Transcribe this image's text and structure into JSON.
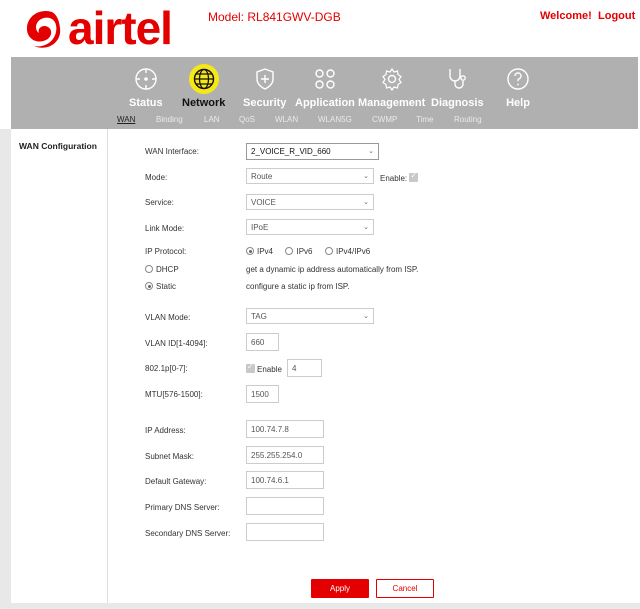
{
  "header": {
    "brand": "airtel",
    "model": "Model: RL841GWV-DGB",
    "welcome": "Welcome!",
    "logout": "Logout"
  },
  "nav": {
    "items": [
      {
        "label": "Status",
        "icon": "status-icon"
      },
      {
        "label": "Network",
        "icon": "globe-icon",
        "active": true
      },
      {
        "label": "Security",
        "icon": "shield-plus-icon"
      },
      {
        "label": "Application",
        "icon": "apps-icon"
      },
      {
        "label": "Management",
        "icon": "gear-icon"
      },
      {
        "label": "Diagnosis",
        "icon": "stethoscope-icon"
      },
      {
        "label": "Help",
        "icon": "help-icon"
      }
    ],
    "subtabs": [
      "WAN",
      "Binding",
      "LAN",
      "QoS",
      "WLAN",
      "WLAN5G",
      "CWMP",
      "Time",
      "Routing"
    ]
  },
  "sidebar": {
    "title": "WAN Configuration"
  },
  "form": {
    "wan_interface_label": "WAN Interface:",
    "wan_interface_value": "2_VOICE_R_VID_660",
    "mode_label": "Mode:",
    "mode_value": "Route",
    "enable_label": "Enable:",
    "service_label": "Service:",
    "service_value": "VOICE",
    "link_mode_label": "Link Mode:",
    "link_mode_value": "IPoE",
    "ip_protocol_label": "IP Protocol:",
    "ip_protocol_options": [
      "IPv4",
      "IPv6",
      "IPv4/IPv6"
    ],
    "dhcp_label": "DHCP",
    "dhcp_desc": "get a dynamic ip address automatically from ISP.",
    "static_label": "Static",
    "static_desc": "configure a static ip from ISP.",
    "vlan_mode_label": "VLAN Mode:",
    "vlan_mode_value": "TAG",
    "vlan_id_label": "VLAN ID[1-4094]:",
    "vlan_id_value": "660",
    "p8021_label": "802.1p[0-7]:",
    "p8021_enable": "Enable",
    "p8021_value": "4",
    "mtu_label": "MTU[576-1500]:",
    "mtu_value": "1500",
    "ip_label": "IP Address:",
    "ip_value": "100.74.7.8",
    "subnet_label": "Subnet Mask:",
    "subnet_value": "255.255.254.0",
    "gateway_label": "Default Gateway:",
    "gateway_value": "100.74.6.1",
    "dns1_label": "Primary DNS Server:",
    "dns1_value": "",
    "dns2_label": "Secondary DNS Server:",
    "dns2_value": ""
  },
  "buttons": {
    "apply": "Apply",
    "cancel": "Cancel"
  },
  "colors": {
    "brand_red": "#e40000",
    "nav_gray": "#b0b0b0",
    "active_yellow": "#f6e719"
  }
}
